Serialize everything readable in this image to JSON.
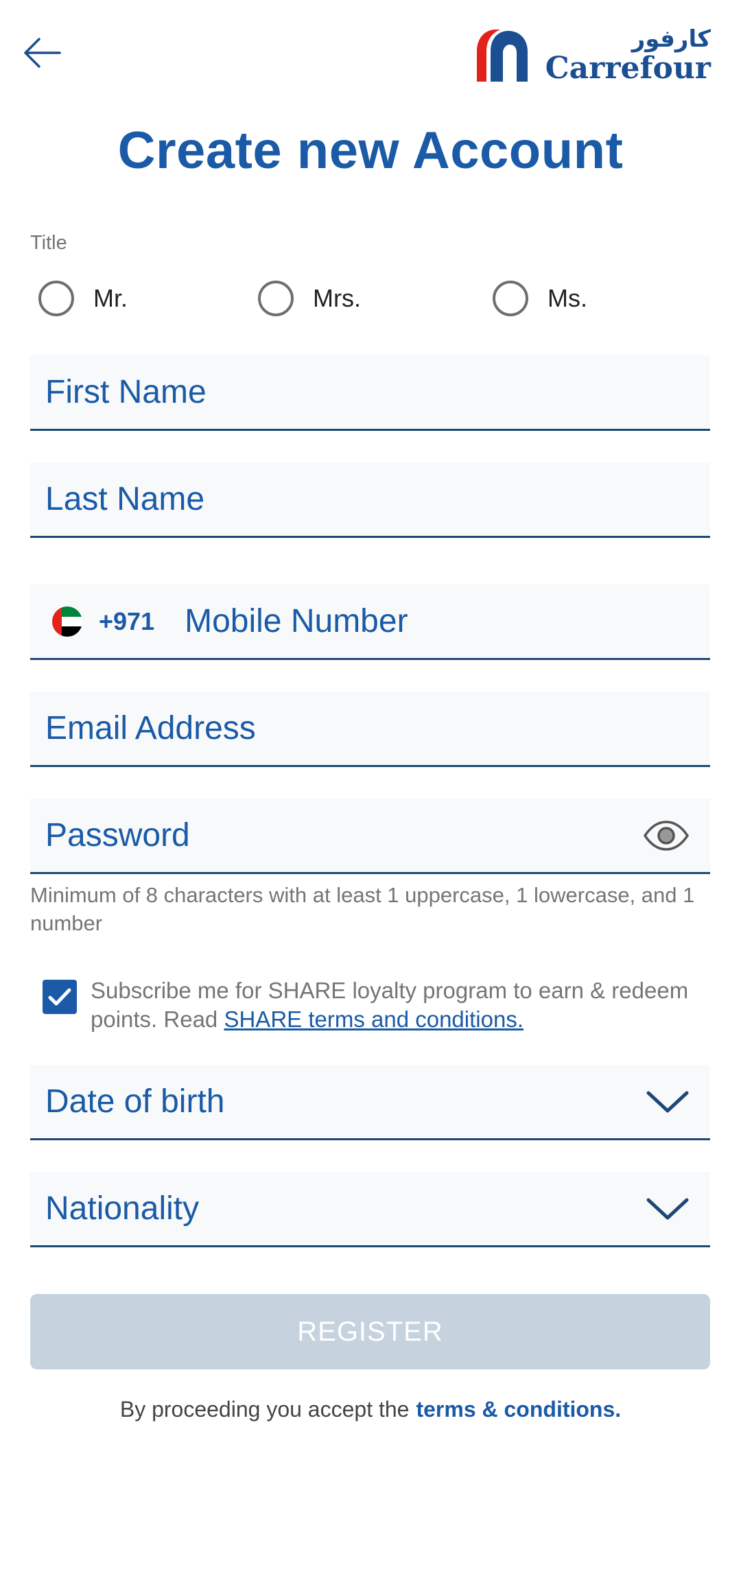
{
  "header": {
    "back_icon": "arrow-left-icon",
    "logo": {
      "arabic": "كارفور",
      "english": "Carrefour",
      "mark_colors": [
        "#e2231a",
        "#1c4f92"
      ]
    }
  },
  "page_title": "Create new Account",
  "title_section": {
    "label": "Title",
    "options": [
      {
        "label": "Mr.",
        "selected": false
      },
      {
        "label": "Mrs.",
        "selected": false
      },
      {
        "label": "Ms.",
        "selected": false
      }
    ]
  },
  "fields": {
    "first_name": {
      "placeholder": "First Name"
    },
    "last_name": {
      "placeholder": "Last Name"
    },
    "mobile": {
      "country_flag": "uae-flag-icon",
      "dial_code": "+971",
      "placeholder": "Mobile Number"
    },
    "email": {
      "placeholder": "Email Address"
    },
    "password": {
      "placeholder": "Password",
      "icon": "eye-icon"
    },
    "password_hint": "Minimum of 8 characters with at least 1 uppercase, 1 lowercase, and 1 number",
    "date_of_birth": {
      "placeholder": "Date of birth",
      "icon": "chevron-down-icon"
    },
    "nationality": {
      "placeholder": "Nationality",
      "icon": "chevron-down-icon"
    }
  },
  "subscribe": {
    "checked": true,
    "text": "Subscribe me for SHARE loyalty program to earn & redeem points. Read ",
    "link_text": "SHARE terms and conditions."
  },
  "register_button": "REGISTER",
  "footer": {
    "text": "By proceeding you accept the",
    "link_text": "terms & conditions."
  },
  "colors": {
    "primary": "#1a5aa6",
    "field_bg": "#f8f9fb",
    "field_border": "#1d4777",
    "register_disabled": "#c6d3df",
    "muted_text": "#757575"
  }
}
